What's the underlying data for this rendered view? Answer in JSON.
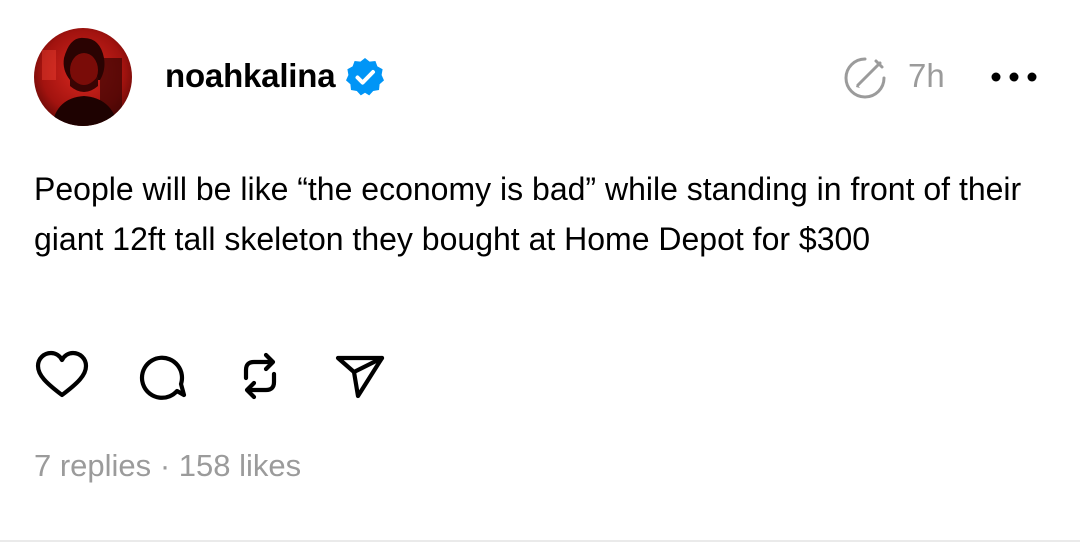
{
  "post": {
    "author": {
      "username": "noahkalina",
      "verified": true,
      "avatar_icon": "avatar-photo-red-tint"
    },
    "timestamp": "7h",
    "icons": {
      "edited": "edited-clock-icon",
      "more": "more-options-icon"
    },
    "text": "People will be like “the economy is bad” while standing in front of their giant 12ft tall skeleton they bought at Home Depot for $300",
    "actions": {
      "like_icon": "heart-icon",
      "reply_icon": "comment-icon",
      "repost_icon": "repost-icon",
      "share_icon": "send-icon"
    },
    "stats": {
      "replies": "7 replies",
      "separator": "·",
      "likes": "158 likes"
    }
  },
  "colors": {
    "verified_blue": "#0095f6",
    "muted_text": "#9b9b9b",
    "text": "#000000"
  }
}
